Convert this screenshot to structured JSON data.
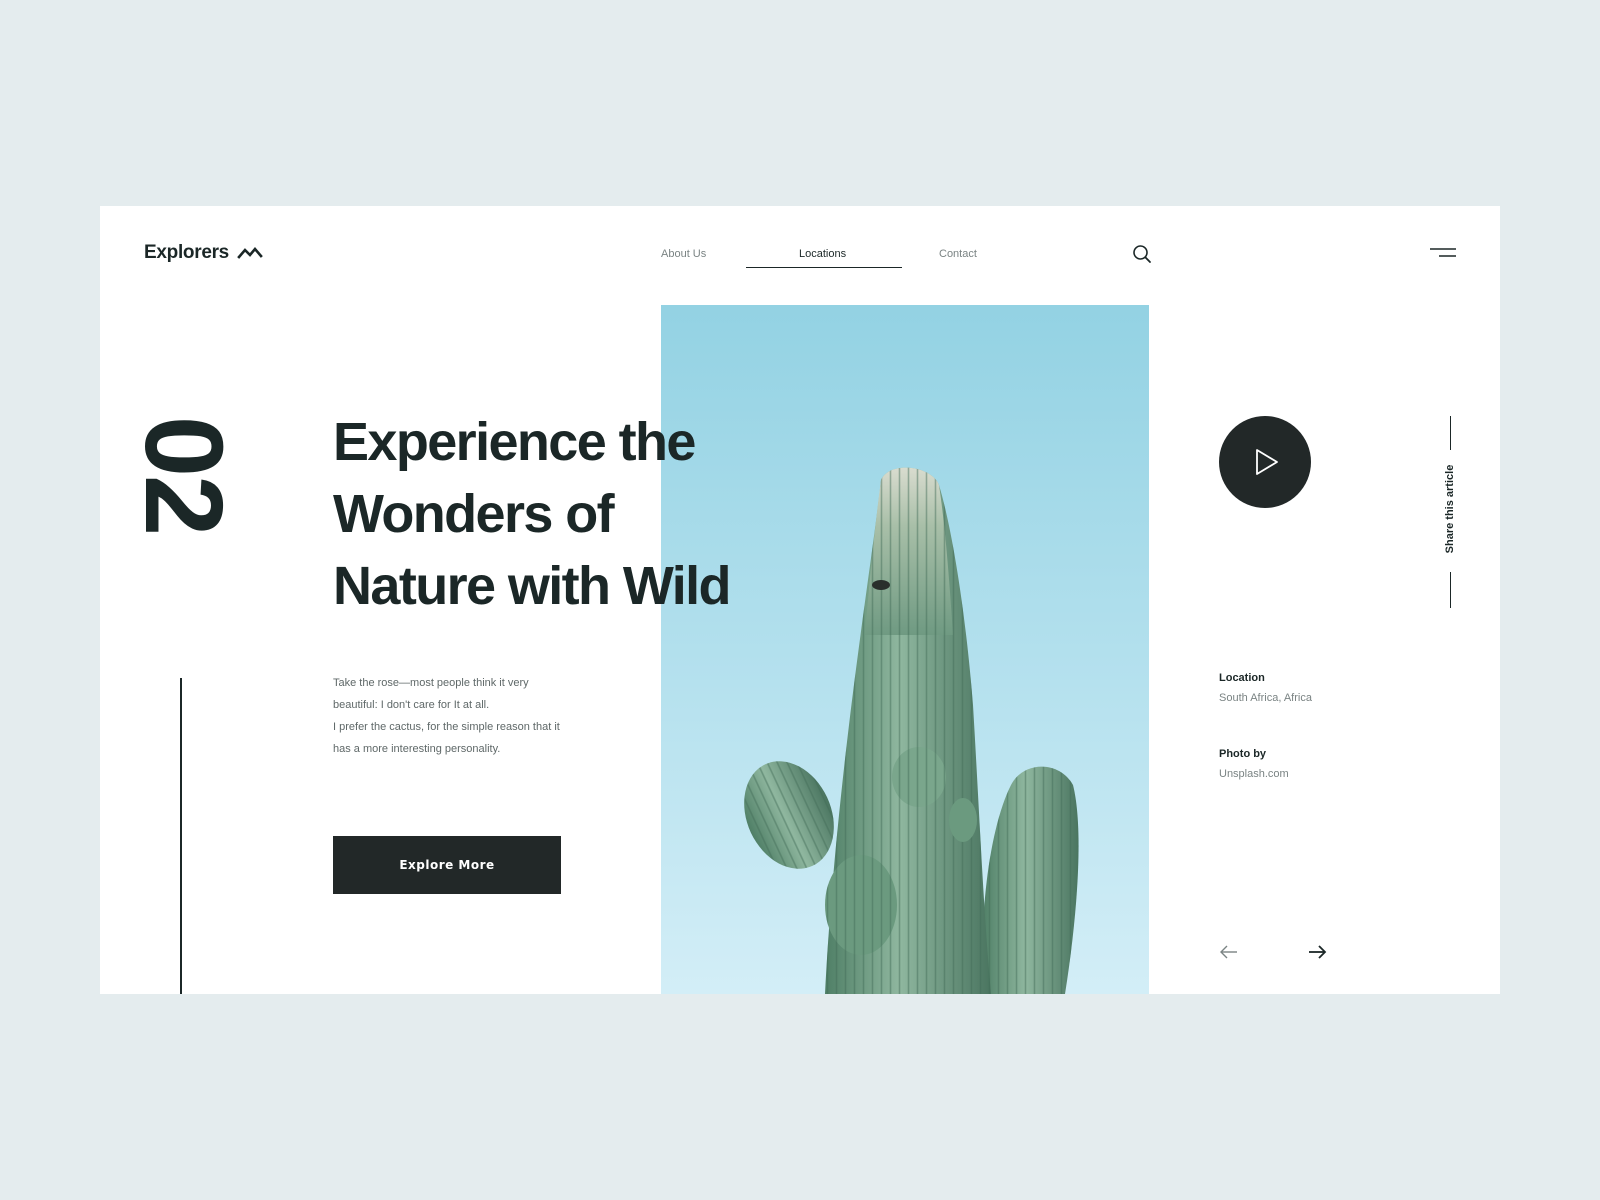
{
  "header": {
    "logo_text": "Explorers",
    "logo_icon": "mountain-zigzag-icon",
    "nav": [
      {
        "label": "About Us",
        "active": false
      },
      {
        "label": "Locations",
        "active": true
      },
      {
        "label": "Contact",
        "active": false
      }
    ],
    "search_icon": "search-icon",
    "menu_icon": "menu-icon"
  },
  "slide": {
    "number": "02",
    "headline_lines": [
      "Experience the",
      "Wonders of",
      "Nature with Wild"
    ],
    "body_lines": [
      "Take the rose—most people think it very",
      "beautiful: I don't care for It at all.",
      "I prefer the cactus, for the simple reason that it",
      "has a more interesting personality."
    ],
    "cta_label": "Explore More"
  },
  "sidebar": {
    "play_icon": "play-icon",
    "share_label": "Share this article",
    "location_label": "Location",
    "location_value": "South Africa, Africa",
    "photo_label": "Photo by",
    "photo_value": "Unsplash.com",
    "prev_icon": "arrow-left-icon",
    "next_icon": "arrow-right-icon"
  },
  "colors": {
    "background": "#e4ecee",
    "card": "#ffffff",
    "ink": "#1b2727",
    "button": "#222828",
    "sky": "#a8dbea",
    "cactus": "#6f9a82"
  }
}
